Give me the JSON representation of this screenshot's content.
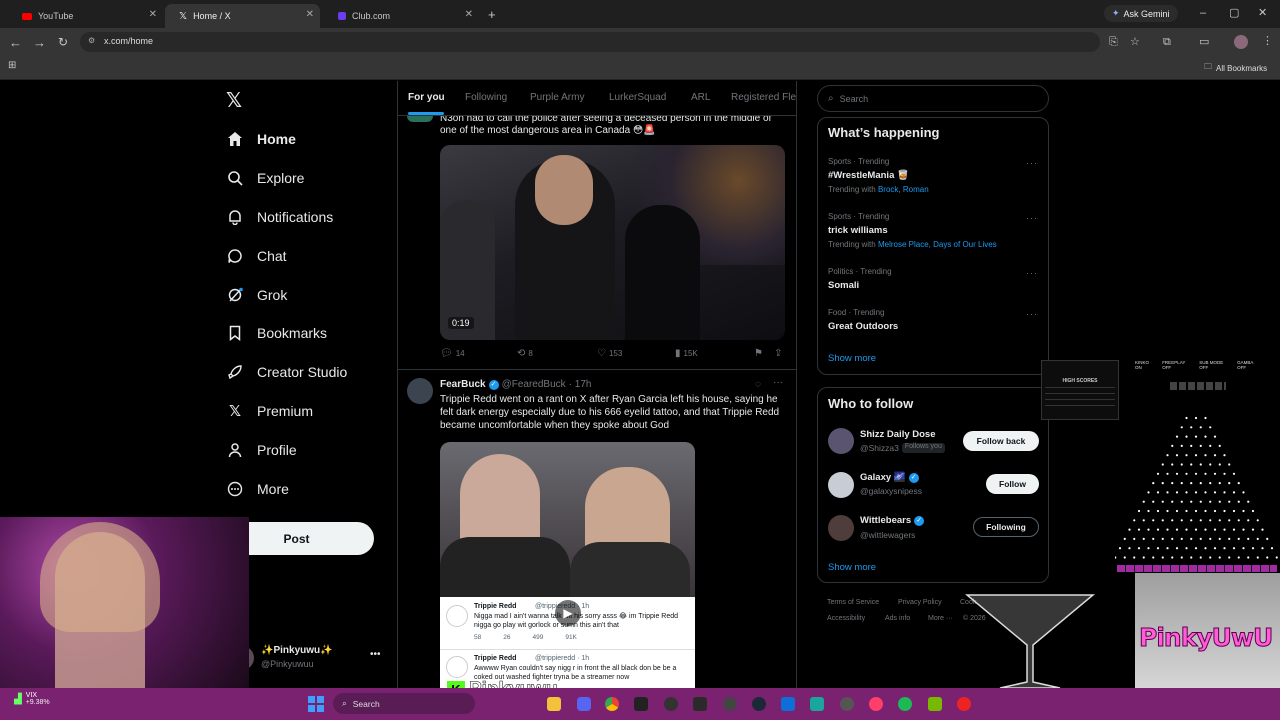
{
  "browser": {
    "tabs": [
      {
        "label": "YouTube",
        "active": false
      },
      {
        "label": "Home / X",
        "active": true
      },
      {
        "label": "Club.com",
        "active": false
      }
    ],
    "ask_gemini": "Ask Gemini",
    "url": "x.com/home",
    "all_bookmarks": "All Bookmarks"
  },
  "sidebar": {
    "items": [
      {
        "label": "Home",
        "icon": "home-icon"
      },
      {
        "label": "Explore",
        "icon": "search-icon"
      },
      {
        "label": "Notifications",
        "icon": "bell-icon"
      },
      {
        "label": "Chat",
        "icon": "chat-icon"
      },
      {
        "label": "Grok",
        "icon": "grok-icon"
      },
      {
        "label": "Bookmarks",
        "icon": "bookmark-icon"
      },
      {
        "label": "Creator Studio",
        "icon": "rocket-icon"
      },
      {
        "label": "Premium",
        "icon": "x-logo-icon"
      },
      {
        "label": "Profile",
        "icon": "person-icon"
      },
      {
        "label": "More",
        "icon": "more-circle-icon"
      }
    ],
    "post_label": "Post",
    "account": {
      "display_name": "✨Pinkyuwu✨",
      "handle": "@Pinkyuwuu"
    }
  },
  "feed": {
    "tabs": [
      "For you",
      "Following",
      "Purple Army",
      "LurkerSquad",
      "ARL",
      "Registered Fle"
    ],
    "tweet1": {
      "text_line1": "N3on had to call the police after seeing a deceased person in the middle of",
      "text_line2": "one of the most dangerous area in Canada 😳🚨",
      "video_duration": "0:19",
      "replies": "14",
      "reposts": "8",
      "likes": "153",
      "views": "15K"
    },
    "tweet2": {
      "author": "FearBuck",
      "handle": "@FearedBuck",
      "time": "· 17h",
      "text": "Trippie Redd went on a rant on X after Ryan Garcia left his house, saying he felt dark energy especially due to his 666 eyelid tattoo, and that Trippie Redd became uncomfortable when they spoke about God",
      "embed1_author": "Trippie Redd",
      "embed1_handle": "@trippieredd · 1h",
      "embed1_text": "Nigga mad I ain't wanna talk wit his sorry asss 😂 im Trippie Redd nigga go play wit gorlock or sumn this ain't that",
      "embed1_stats": [
        "58",
        "26",
        "499",
        "91K"
      ],
      "embed2_author": "Trippie Redd",
      "embed2_handle": "@trippieredd · 1h",
      "embed2_text": "Awwww Ryan couldn't say nigg r in front the all black don be be a coked out washed fighter tryna be a streamer now"
    }
  },
  "right": {
    "search_placeholder": "Search",
    "whats_happening": "What’s happening",
    "trends": [
      {
        "meta": "Sports · Trending",
        "name": "#WrestleMania 🥃",
        "with_prefix": "Trending with",
        "with": "Brock, Roman"
      },
      {
        "meta": "Sports · Trending",
        "name": "trick williams",
        "with_prefix": "Trending with",
        "with": "Melrose Place, Days of Our Lives"
      },
      {
        "meta": "Politics · Trending",
        "name": "Somali",
        "with_prefix": "",
        "with": ""
      },
      {
        "meta": "Food · Trending",
        "name": "Great Outdoors",
        "with_prefix": "",
        "with": ""
      }
    ],
    "show_more": "Show more",
    "who_to_follow": "Who to follow",
    "follows": [
      {
        "name": "Shizz Daily Dose",
        "handle": "@Shizza3",
        "badge": "Follows you",
        "button": "Follow back"
      },
      {
        "name": "Galaxy 🌌",
        "handle": "@galaxysnipess",
        "badge": "",
        "button": "Follow"
      },
      {
        "name": "Wittlebears",
        "handle": "@wittlewagers",
        "badge": "",
        "button": "Following"
      }
    ],
    "show_more_2": "Show more",
    "footer": [
      "Terms of Service",
      "Privacy Policy",
      "Cook",
      "Accessibility",
      "Ads info",
      "More ···",
      "© 2026"
    ]
  },
  "overlay": {
    "streamer_name": "Pinkyuwu",
    "logo_text": "PinkyUwU",
    "scoreboard_title": "HIGH SCORES",
    "kinko_labels": [
      "KINKO ON",
      "FREEPLAY OFF",
      "SUB MODE OFF",
      "GAMBA OFF"
    ]
  },
  "taskbar": {
    "ticker_name": "VIX",
    "ticker_change": "+9.38%",
    "search_label": "Search"
  },
  "colors": {
    "accent": "#1d9bf0",
    "taskbar": "#7a2270",
    "background": "#000000"
  }
}
